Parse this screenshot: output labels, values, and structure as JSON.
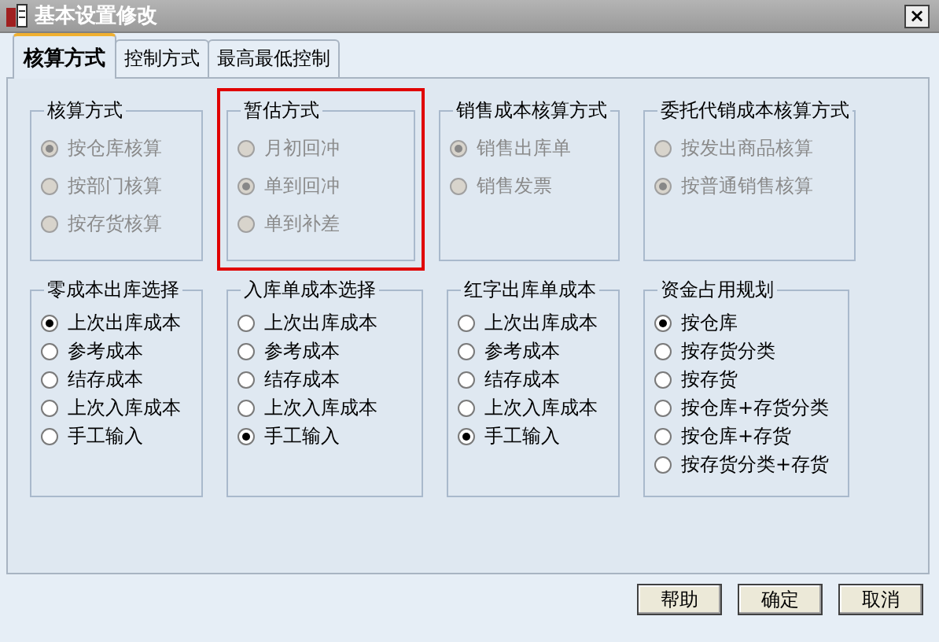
{
  "window": {
    "title": "基本设置修改",
    "close": "×"
  },
  "tabs": [
    {
      "label": "核算方式",
      "selected": true
    },
    {
      "label": "控制方式",
      "selected": false
    },
    {
      "label": "最高最低控制",
      "selected": false
    }
  ],
  "rows": [
    {
      "groups": [
        {
          "title": "核算方式",
          "highlighted": false,
          "options": [
            {
              "label": "按仓库核算",
              "selected": true,
              "disabled": true
            },
            {
              "label": "按部门核算",
              "selected": false,
              "disabled": true
            },
            {
              "label": "按存货核算",
              "selected": false,
              "disabled": true
            }
          ]
        },
        {
          "title": "暂估方式",
          "highlighted": true,
          "options": [
            {
              "label": "月初回冲",
              "selected": false,
              "disabled": true
            },
            {
              "label": "单到回冲",
              "selected": true,
              "disabled": true
            },
            {
              "label": "单到补差",
              "selected": false,
              "disabled": true
            }
          ]
        },
        {
          "title": "销售成本核算方式",
          "highlighted": false,
          "options": [
            {
              "label": "销售出库单",
              "selected": true,
              "disabled": true
            },
            {
              "label": "销售发票",
              "selected": false,
              "disabled": true
            }
          ]
        },
        {
          "title": "委托代销成本核算方式",
          "highlighted": false,
          "options": [
            {
              "label": "按发出商品核算",
              "selected": false,
              "disabled": true
            },
            {
              "label": "按普通销售核算",
              "selected": true,
              "disabled": true
            }
          ]
        }
      ]
    },
    {
      "groups": [
        {
          "title": "零成本出库选择",
          "options": [
            {
              "label": "上次出库成本",
              "selected": true,
              "disabled": false
            },
            {
              "label": "参考成本",
              "selected": false,
              "disabled": false
            },
            {
              "label": "结存成本",
              "selected": false,
              "disabled": false
            },
            {
              "label": "上次入库成本",
              "selected": false,
              "disabled": false
            },
            {
              "label": "手工输入",
              "selected": false,
              "disabled": false
            }
          ]
        },
        {
          "title": "入库单成本选择",
          "options": [
            {
              "label": "上次出库成本",
              "selected": false,
              "disabled": false
            },
            {
              "label": "参考成本",
              "selected": false,
              "disabled": false
            },
            {
              "label": "结存成本",
              "selected": false,
              "disabled": false
            },
            {
              "label": "上次入库成本",
              "selected": false,
              "disabled": false
            },
            {
              "label": "手工输入",
              "selected": true,
              "disabled": false
            }
          ]
        },
        {
          "title": "红字出库单成本",
          "options": [
            {
              "label": "上次出库成本",
              "selected": false,
              "disabled": false
            },
            {
              "label": "参考成本",
              "selected": false,
              "disabled": false
            },
            {
              "label": "结存成本",
              "selected": false,
              "disabled": false
            },
            {
              "label": "上次入库成本",
              "selected": false,
              "disabled": false
            },
            {
              "label": "手工输入",
              "selected": true,
              "disabled": false
            }
          ]
        },
        {
          "title": "资金占用规划",
          "options": [
            {
              "label": "按仓库",
              "selected": true,
              "disabled": false
            },
            {
              "label": "按存货分类",
              "selected": false,
              "disabled": false
            },
            {
              "label": "按存货",
              "selected": false,
              "disabled": false
            },
            {
              "label": "按仓库+存货分类",
              "selected": false,
              "disabled": false
            },
            {
              "label": "按仓库+存货",
              "selected": false,
              "disabled": false
            },
            {
              "label": "按存货分类+存货",
              "selected": false,
              "disabled": false
            }
          ]
        }
      ]
    }
  ],
  "buttons": [
    "帮助",
    "确定",
    "取消"
  ]
}
